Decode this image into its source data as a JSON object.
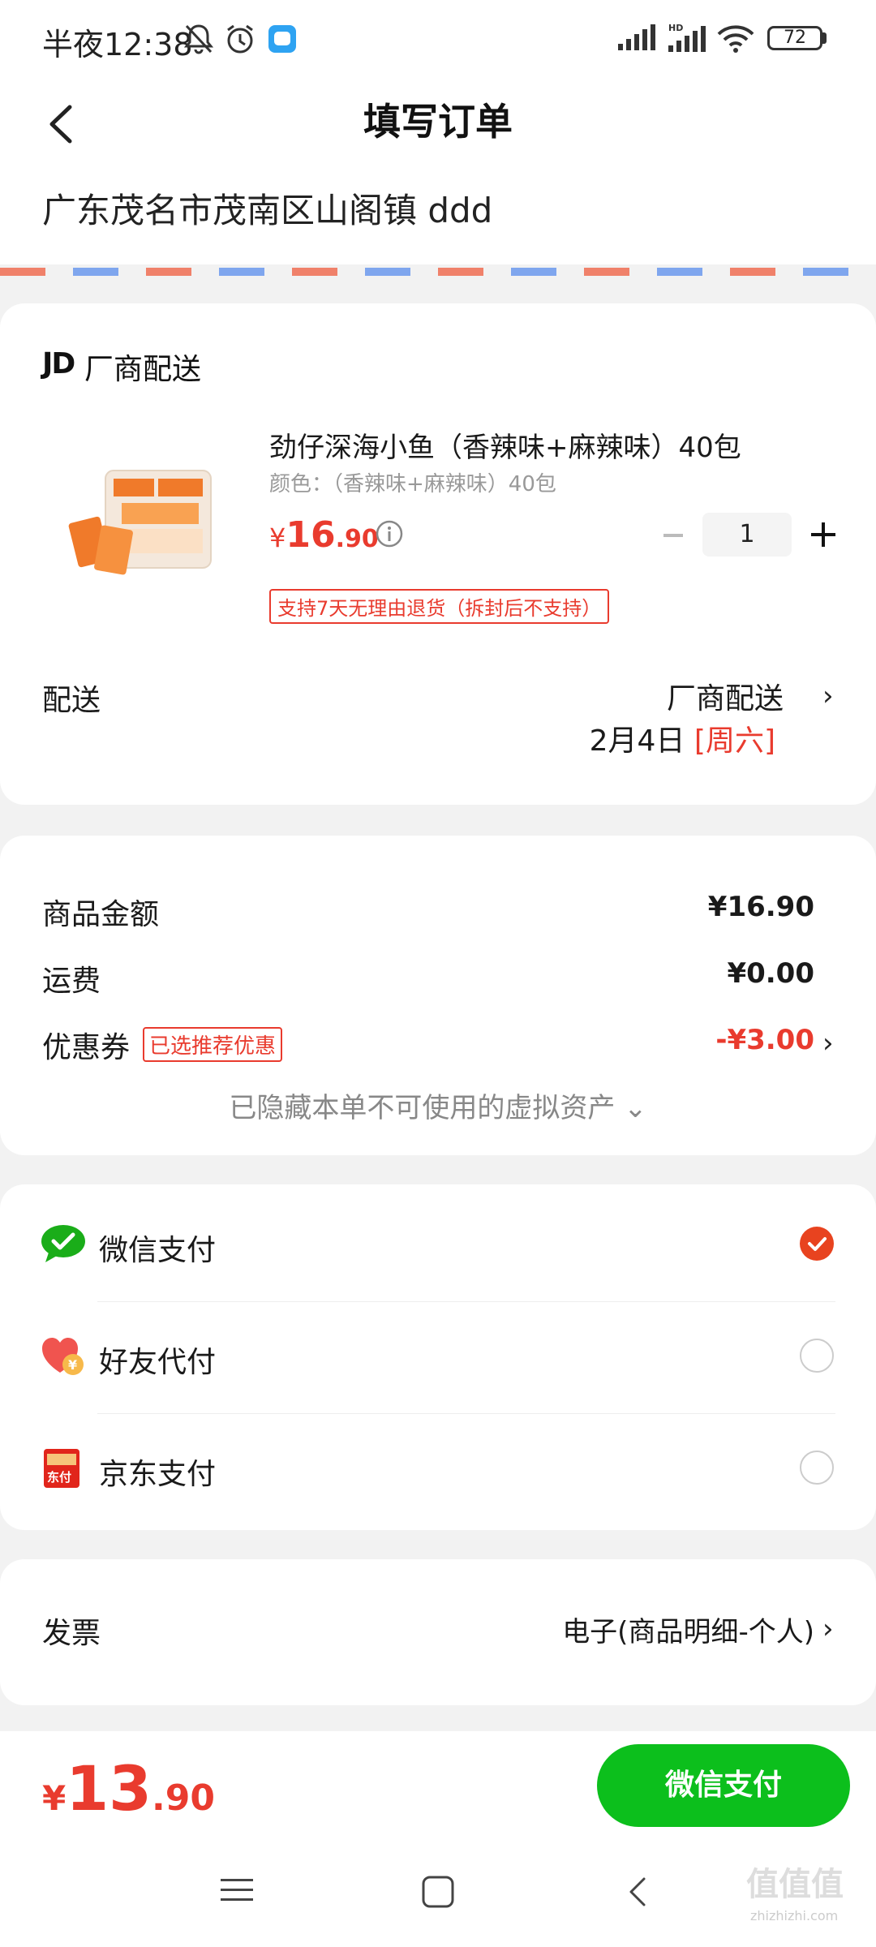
{
  "status_bar": {
    "time": "半夜12:38",
    "battery": "72"
  },
  "header": {
    "title": "填写订单"
  },
  "address": {
    "text": "广东茂名市茂南区山阁镇 ddd"
  },
  "vendor": {
    "logo": "JD",
    "label": "厂商配送"
  },
  "product": {
    "name": "劲仔深海小鱼（香辣味+麻辣味）40包",
    "variant": "颜色：（香辣味+麻辣味）40包",
    "price_symbol": "¥",
    "price_int": "16",
    "price_dec": ".90",
    "quantity": "1",
    "return_policy": "支持7天无理由退货（拆封后不支持）"
  },
  "shipping": {
    "label": "配送",
    "method": "厂商配送",
    "date": "2月4日",
    "weekday": "[周六]"
  },
  "amounts": {
    "goods_label": "商品金额",
    "goods_value": "¥16.90",
    "freight_label": "运费",
    "freight_value": "¥0.00",
    "coupon_label": "优惠券",
    "coupon_badge": "已选推荐优惠",
    "coupon_value": "-¥3.00",
    "hidden_assets": "已隐藏本单不可使用的虚拟资产 ⌄"
  },
  "payment": {
    "options": [
      {
        "label": "微信支付",
        "icon": "wechat-pay-icon",
        "selected": true
      },
      {
        "label": "好友代付",
        "icon": "friend-pay-icon",
        "selected": false
      },
      {
        "label": "京东支付",
        "icon": "jd-pay-icon",
        "selected": false
      }
    ]
  },
  "invoice": {
    "label": "发票",
    "value": "电子(商品明细-个人)"
  },
  "footer": {
    "price_symbol": "¥",
    "price_int": "13",
    "price_dec": ".90",
    "pay_button": "微信支付"
  },
  "watermark": {
    "text": "值值值",
    "sub": "zhizhizhi.com"
  },
  "colors": {
    "accent_red": "#e93b2e",
    "wechat_green": "#0cbf1c",
    "radio_selected": "#e8431f"
  }
}
